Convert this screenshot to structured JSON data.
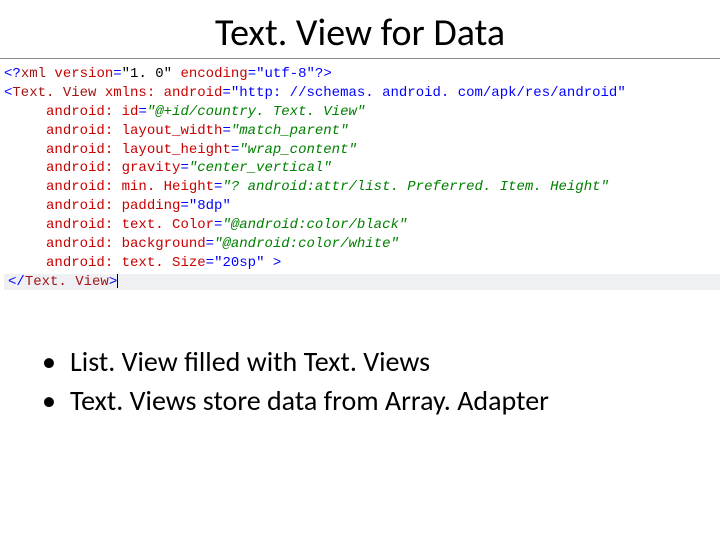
{
  "title": "Text. View for Data",
  "code": {
    "xml_decl": {
      "open": "<?",
      "tag": "xml",
      "attr1_name": " version",
      "eq": "=",
      "attr1_val": "\"1. 0\"",
      "attr2_name": " encoding",
      "attr2_val": "\"utf-8\"",
      "close": "?>"
    },
    "textview": {
      "open": "<",
      "tag": "Text. View",
      "close_tag": "</",
      "close_tag_end": ">",
      "end_gt": " >",
      "attrs": [
        {
          "name": " xmlns: android",
          "val": "\"http: //schemas. android. com/apk/res/android\""
        },
        {
          "name": "android: id",
          "val": "\"@+id/country. Text. View\""
        },
        {
          "name": "android: layout_width",
          "val": "\"match_parent\""
        },
        {
          "name": "android: layout_height",
          "val": "\"wrap_content\""
        },
        {
          "name": "android: gravity",
          "val": "\"center_vertical\""
        },
        {
          "name": "android: min. Height",
          "val": "\"? android:attr/list. Preferred. Item. Height\""
        },
        {
          "name": "android: padding",
          "val": "\"8dp\""
        },
        {
          "name": "android: text. Color",
          "val": "\"@android:color/black\""
        },
        {
          "name": "android: background",
          "val": "\"@android:color/white\""
        },
        {
          "name": "android: text. Size",
          "val": "\"20sp\""
        }
      ]
    }
  },
  "bullets": [
    "List. View filled with Text. Views",
    "Text. Views store data from Array. Adapter"
  ]
}
